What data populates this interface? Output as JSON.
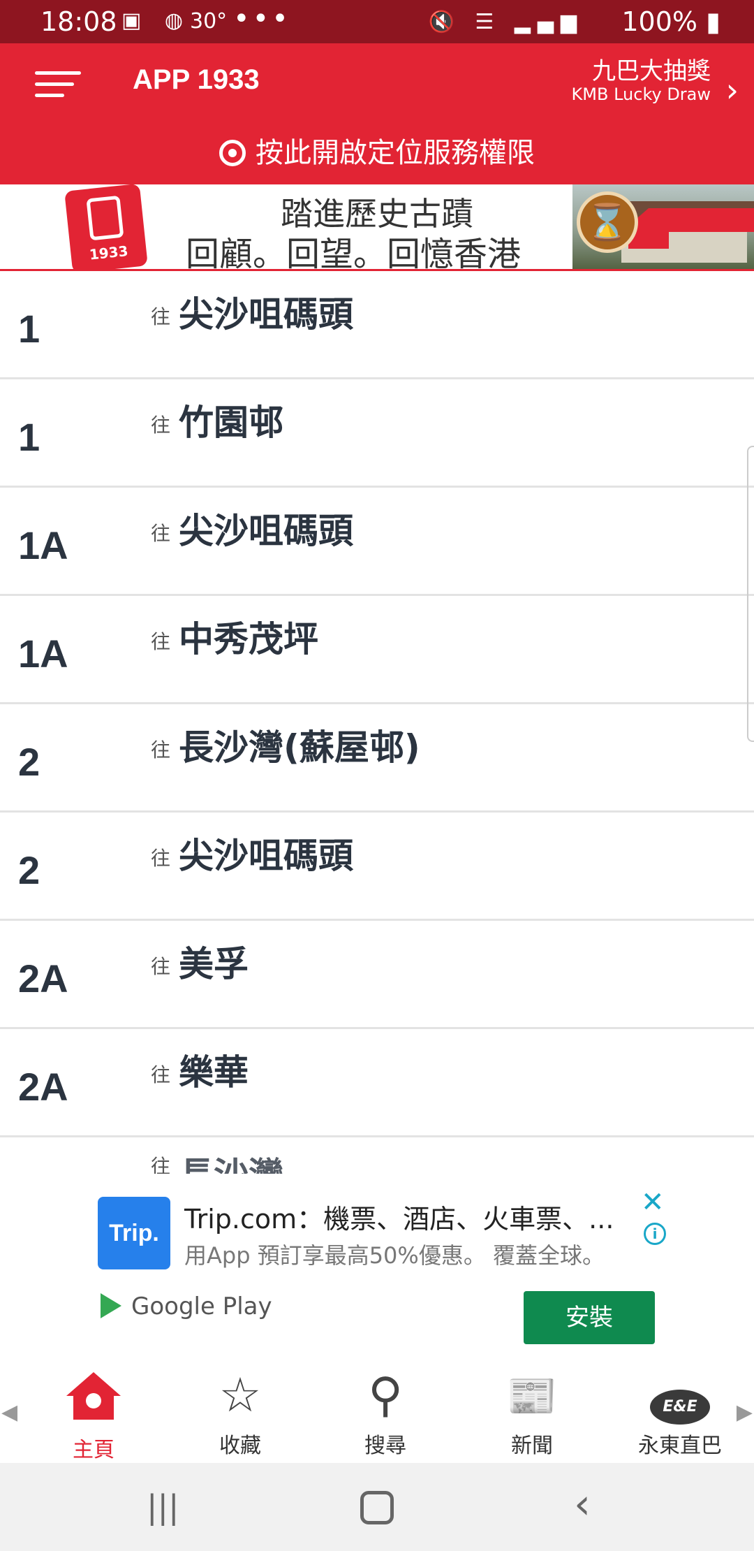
{
  "status_bar": {
    "time": "18:08",
    "left_icons": "▣ ◍",
    "temperature": "30°",
    "more": "•••",
    "right_icons": "🔇 ☰ ▂▄▆",
    "battery": "100% ▮"
  },
  "header": {
    "menu_icon": "hamburger-menu-icon",
    "title": "APP 1933",
    "lucky_draw_zh": "九巴大抽獎",
    "lucky_draw_en": "KMB Lucky Draw",
    "lucky_chevron": "›",
    "location_prompt": "按此開啟定位服務權限",
    "accent_color": "#e22434"
  },
  "banner": {
    "logo_year": "1933",
    "line1": "踏進歷史古蹟",
    "line2": "回顧。回望。回憶香港",
    "hourglass": "⌛"
  },
  "routes": [
    {
      "number": "1",
      "to": "往",
      "destination": "尖沙咀碼頭"
    },
    {
      "number": "1",
      "to": "往",
      "destination": "竹園邨"
    },
    {
      "number": "1A",
      "to": "往",
      "destination": "尖沙咀碼頭"
    },
    {
      "number": "1A",
      "to": "往",
      "destination": "中秀茂坪"
    },
    {
      "number": "2",
      "to": "往",
      "destination": "長沙灣(蘇屋邨)"
    },
    {
      "number": "2",
      "to": "往",
      "destination": "尖沙咀碼頭"
    },
    {
      "number": "2A",
      "to": "往",
      "destination": "美孚"
    },
    {
      "number": "2A",
      "to": "往",
      "destination": "樂華"
    },
    {
      "number": "",
      "to": "往",
      "destination": "長沙灣"
    }
  ],
  "ad": {
    "icon_text": "Trip.",
    "title": "Trip.com：機票、酒店、火車票、...",
    "subtitle": "用App 預訂享最高50%優惠。 覆蓋全球。",
    "store": "Google Play",
    "install": "安裝",
    "close": "✕",
    "info": "i"
  },
  "tabs": [
    {
      "label": "主頁",
      "icon": "home-icon",
      "glyph": ""
    },
    {
      "label": "收藏",
      "icon": "star-icon",
      "glyph": "☆"
    },
    {
      "label": "搜尋",
      "icon": "search-icon",
      "glyph": "⚲"
    },
    {
      "label": "新聞",
      "icon": "news-icon",
      "glyph": "📰"
    },
    {
      "label": "永東直巴",
      "icon": "ee-logo-icon",
      "glyph": "E&E"
    }
  ],
  "tab_arrows": {
    "left": "◀",
    "right": "▶"
  },
  "navbar": {
    "recents": "|||",
    "back": "‹"
  }
}
